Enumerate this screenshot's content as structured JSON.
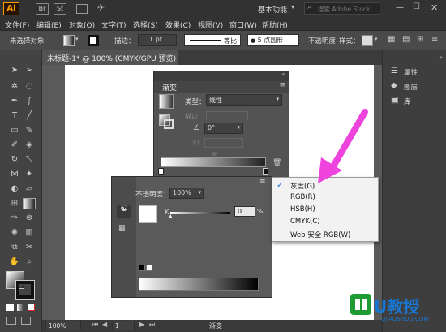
{
  "app": {
    "logo": "Ai",
    "br": "Br",
    "st": "St",
    "workspace": "基本功能",
    "search_placeholder": "搜索 Adobe Stock"
  },
  "menu": [
    "文件(F)",
    "编辑(E)",
    "对象(O)",
    "文字(T)",
    "选择(S)",
    "效果(C)",
    "视图(V)",
    "窗口(W)",
    "帮助(H)"
  ],
  "control": {
    "selection": "未选择对象",
    "stroke_label": "描边：",
    "stroke_value": "1 pt",
    "line_style": "等比",
    "brush": "5 点圆形",
    "opacity_label": "不透明度",
    "style_label": "样式："
  },
  "document_tab": "未标题-1* @ 100% (CMYK/GPU 预览)",
  "gradient_panel": {
    "title": "渐变",
    "type_label": "类型：",
    "type_value": "线性",
    "stroke_label": "描边",
    "angle_value": "0°",
    "opacity_label": "不透明度：",
    "opacity_value": "100%",
    "location_label": "位置：",
    "k_label": "K",
    "k_value": "0",
    "percent": "%"
  },
  "flyout": {
    "items": [
      {
        "label": "灰度(G)",
        "checked": true
      },
      {
        "label": "RGB(R)",
        "checked": false
      },
      {
        "label": "HSB(H)",
        "checked": false
      },
      {
        "label": "CMYK(C)",
        "checked": false
      },
      {
        "label": "Web 安全 RGB(W)",
        "checked": false
      }
    ]
  },
  "right_panel": {
    "items": [
      "属性",
      "图层",
      "库"
    ]
  },
  "status": {
    "zoom": "100%",
    "page": "1",
    "mode": "渐变"
  },
  "watermark": {
    "brand": "U教授",
    "url": "UJIAOSHOU.COM"
  },
  "colors": {
    "accent_arrow": "#ee44dd",
    "check": "#1d6fd6"
  }
}
